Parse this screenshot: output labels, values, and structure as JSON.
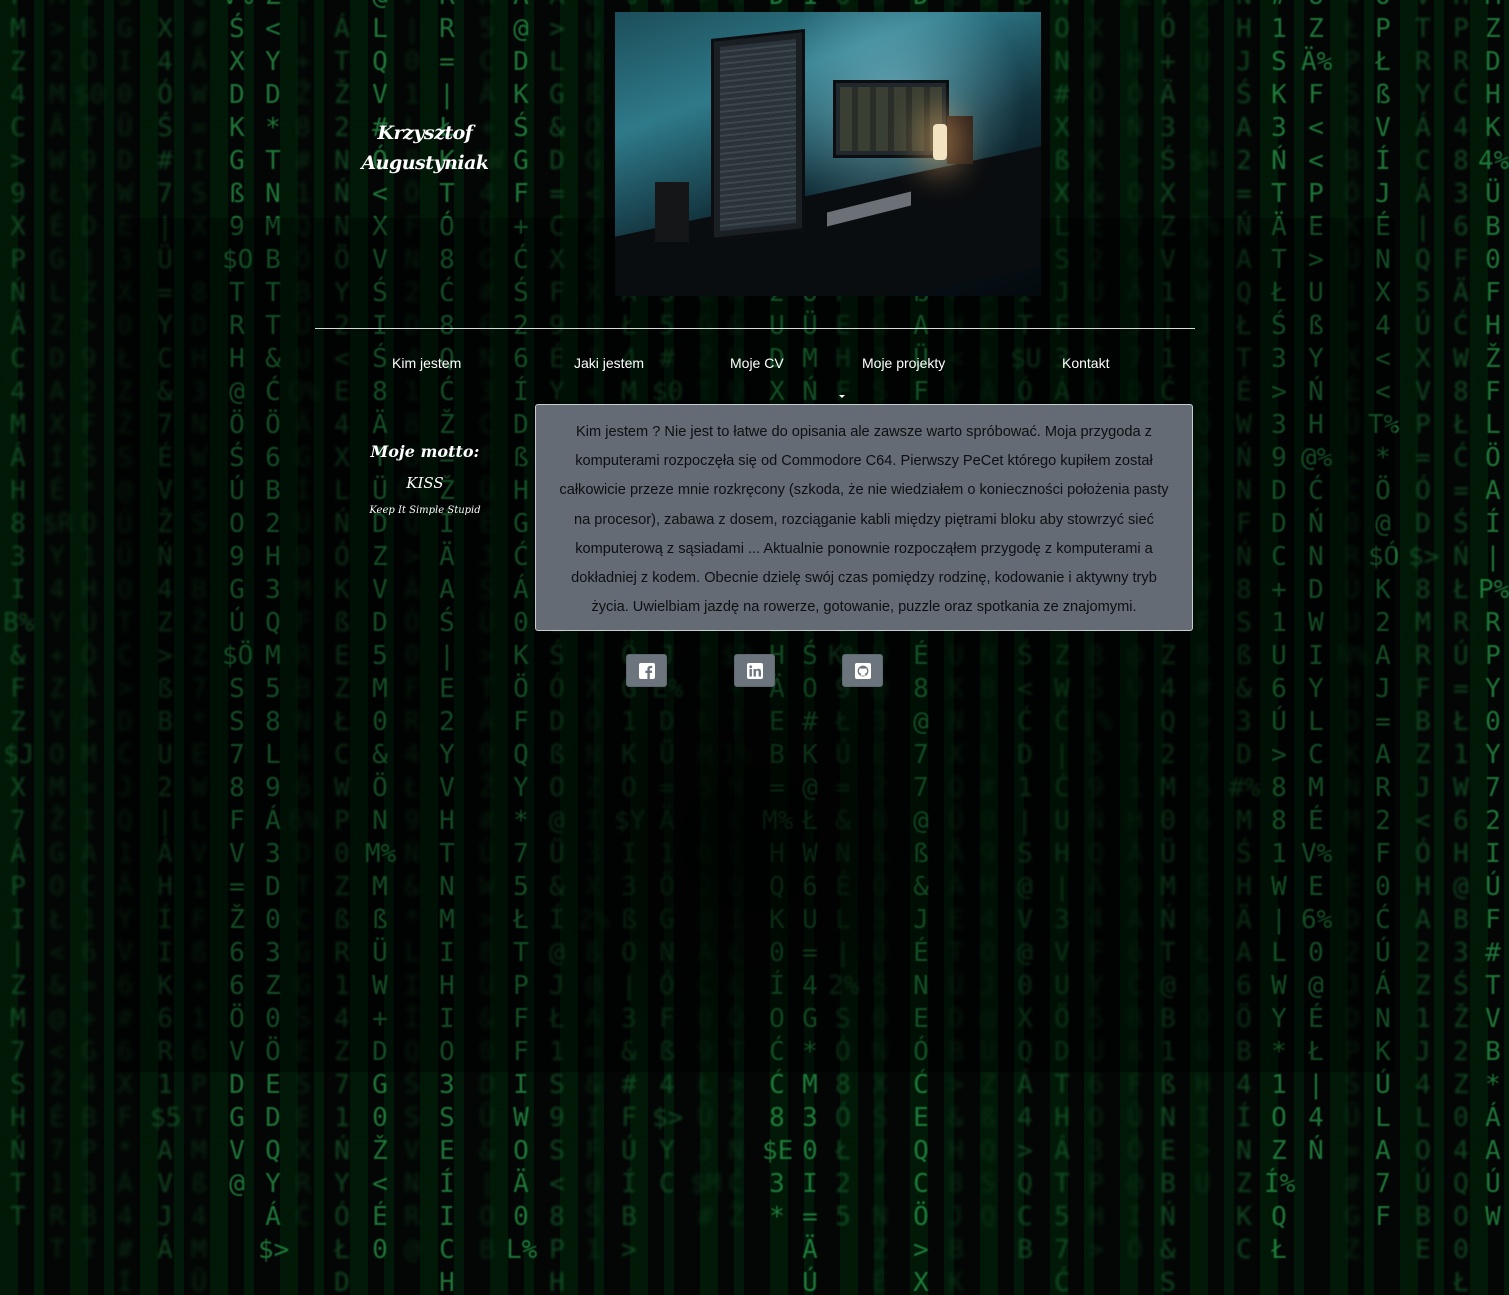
{
  "header": {
    "name_line1": "Krzysztof",
    "name_line2": "Augustyniak"
  },
  "nav": {
    "items": [
      "Kim jestem",
      "Jaki jestem",
      "Moje CV",
      "Moje projekty",
      "Kontakt"
    ]
  },
  "motto": {
    "heading": "Moje motto:",
    "acronym": "KISS",
    "expansion": "Keep It Simple Stupid"
  },
  "about": {
    "text": "Kim jestem ? Nie jest to łatwe do opisania ale zawsze warto spróbować. Moja przygoda z komputerami rozpoczęła się od Commodore C64. Pierwszy PeCet którego kupiłem został całkowicie przeze mnie rozkręcony (szkoda, że nie wiedziałem o konieczności położenia pasty na procesor), zabawa z dosem, rozciąganie kabli między piętrami bloku aby stowrzyć sieć komputerową z sąsiadami ... Aktualnie ponownie rozpocząłem przygodę z komputerami a dokładniej z kodem. Obecnie dzielę swój czas pomiędzy rodzinę, kodowanie i aktywny tryb życia. Uwielbiam jazdę na rowerze, gotowanie, puzzle oraz spotkania ze znajomymi."
  },
  "social": {
    "icons": [
      "facebook-icon",
      "linkedin-icon",
      "github-icon"
    ]
  },
  "colors": {
    "background": "#030604",
    "matrix_green": "#1f7a3a",
    "panel": "#646b74",
    "button": "#6c757d",
    "text_light": "#ffffff"
  }
}
